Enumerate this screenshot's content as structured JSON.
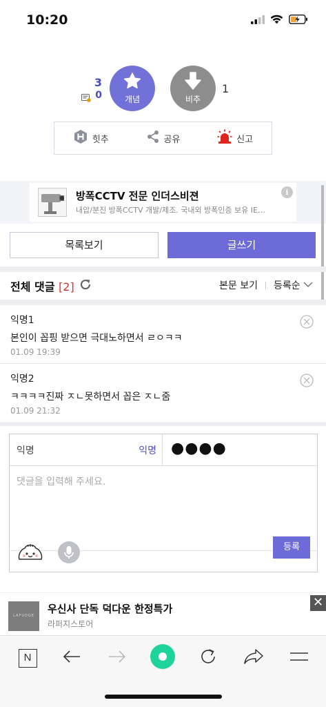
{
  "status": {
    "time": "10:20"
  },
  "vote": {
    "up_count": "3",
    "fix_count": "0",
    "up_label": "개념",
    "down_label": "비추",
    "down_count": "1"
  },
  "actions": [
    {
      "label": "힛추",
      "icon": "hit-icon"
    },
    {
      "label": "공유",
      "icon": "share-icon"
    },
    {
      "label": "신고",
      "icon": "siren-icon"
    }
  ],
  "ad": {
    "title": "방폭CCTV 전문 인더스비젼",
    "desc": "내압/분진 방폭CCTV 개발/제조. 국내외 방폭인증 보유 IE…",
    "info": "i"
  },
  "buttons": {
    "list": "목록보기",
    "write": "글쓰기"
  },
  "comments_header": {
    "title": "전체 댓글",
    "count": "[2]",
    "view": "본문 보기",
    "sort": "등록순"
  },
  "comments": [
    {
      "nick": "익명1",
      "text": "본인이 꼽핑 받으면 극대노하면서 ㄹㅇㅋㅋ",
      "date": "01.09 19:39"
    },
    {
      "nick": "익명2",
      "text": "ㅋㅋㅋㅋ진짜 ㅈㄴ못하면서 꼽은 ㅈㄴ줌",
      "date": "01.09 21:32"
    }
  ],
  "form": {
    "name_placeholder": "익명",
    "name_mode": "익명",
    "password": "●●●●",
    "text_placeholder": "댓글을 입력해 주세요.",
    "submit": "등록"
  },
  "bottom_ad": {
    "title": "우신사 단독 덕다운 한정특가",
    "sub": "라퍼지스토어",
    "thumb_text": "LAFUDGE",
    "close": "✕"
  },
  "toolbar": {
    "n_label": "N"
  },
  "colors": {
    "accent": "#6d6bd8",
    "count_red": "#d9322d",
    "green": "#1ed49a"
  }
}
